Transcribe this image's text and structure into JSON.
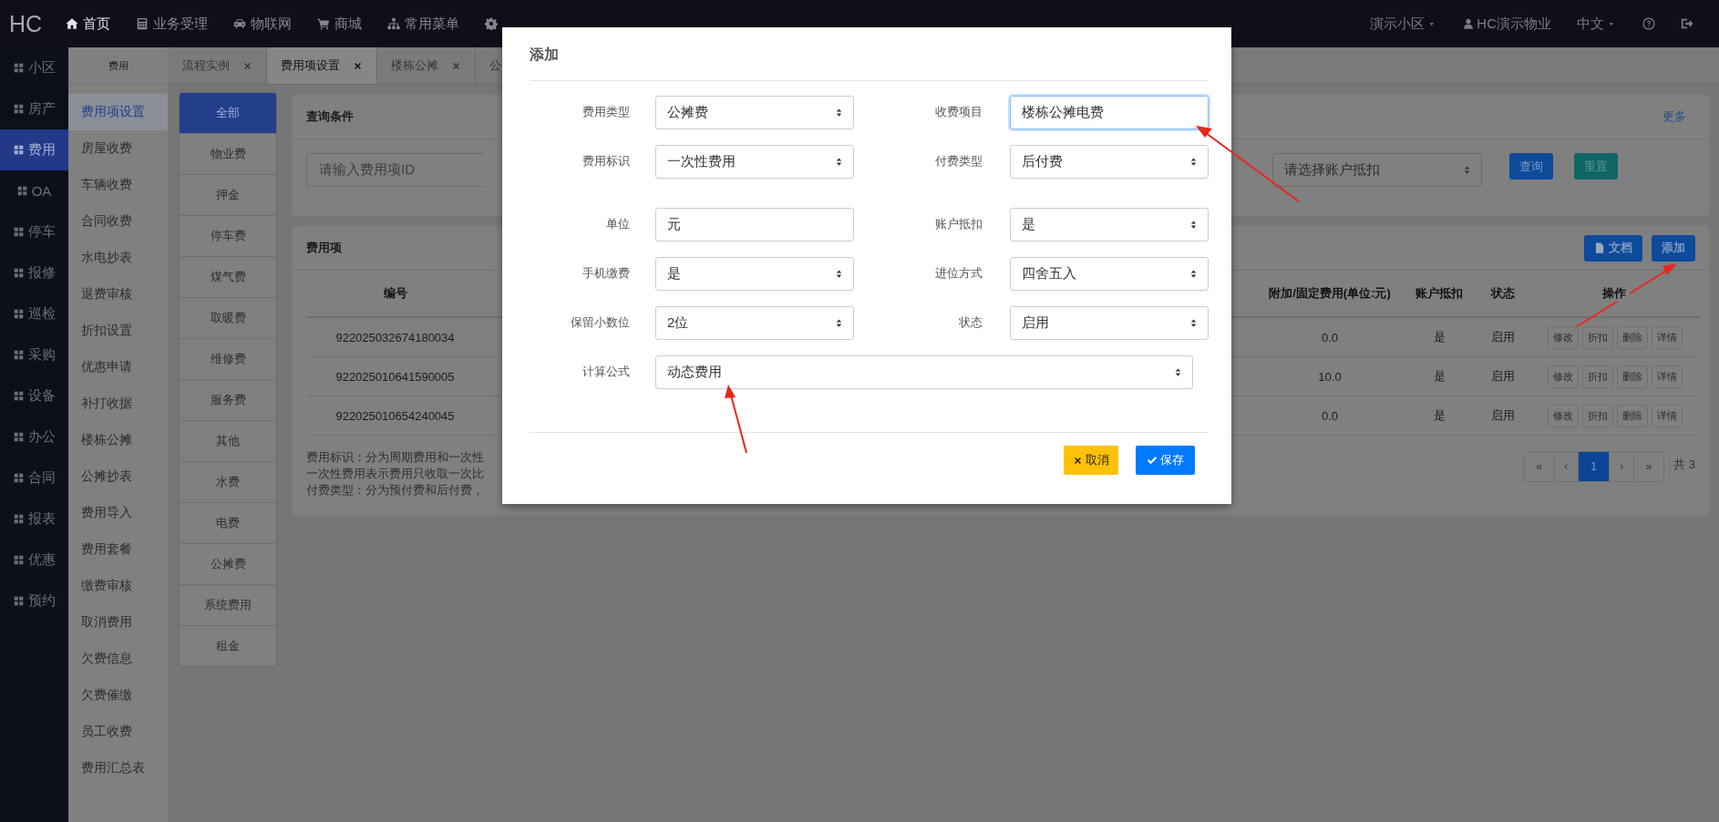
{
  "topbar": {
    "logo": "HC",
    "menu": [
      {
        "label": "首页",
        "kind": "home",
        "selected": true
      },
      {
        "label": "业务受理",
        "kind": "calculator",
        "selected": false
      },
      {
        "label": "物联网",
        "kind": "car",
        "selected": false
      },
      {
        "label": "商城",
        "kind": "cart",
        "selected": false
      },
      {
        "label": "常用菜单",
        "kind": "sitemap",
        "selected": false
      },
      {
        "kind": "gear",
        "selected": false
      }
    ],
    "right": [
      {
        "kind": "dropdown",
        "label": "演示小区"
      },
      {
        "kind": "user",
        "label": "HC演示物业"
      },
      {
        "kind": "dropdown",
        "label": "中文"
      },
      {
        "kind": "help"
      },
      {
        "kind": "logout"
      }
    ]
  },
  "main_nav": [
    {
      "label": "小区",
      "selected": false
    },
    {
      "label": "房产",
      "selected": false
    },
    {
      "label": "费用",
      "selected": true
    },
    {
      "label": "OA",
      "selected": false
    },
    {
      "label": "停车",
      "selected": false
    },
    {
      "label": "报修",
      "selected": false
    },
    {
      "label": "巡检",
      "selected": false
    },
    {
      "label": "采购",
      "selected": false
    },
    {
      "label": "设备",
      "selected": false
    },
    {
      "label": "办公",
      "selected": false
    },
    {
      "label": "合同",
      "selected": false
    },
    {
      "label": "报表",
      "selected": false
    },
    {
      "label": "优惠",
      "selected": false
    },
    {
      "label": "预约",
      "selected": false
    }
  ],
  "sub_nav": {
    "title": "费用",
    "items": [
      {
        "label": "费用项设置",
        "selected": true
      },
      {
        "label": "房屋收费",
        "selected": false
      },
      {
        "label": "车辆收费",
        "selected": false
      },
      {
        "label": "合同收费",
        "selected": false
      },
      {
        "label": "水电抄表",
        "selected": false
      },
      {
        "label": "退费审核",
        "selected": false
      },
      {
        "label": "折扣设置",
        "selected": false
      },
      {
        "label": "优惠申请",
        "selected": false
      },
      {
        "label": "补打收据",
        "selected": false
      },
      {
        "label": "楼栋公摊",
        "selected": false
      },
      {
        "label": "公摊抄表",
        "selected": false
      },
      {
        "label": "费用导入",
        "selected": false
      },
      {
        "label": "费用套餐",
        "selected": false
      },
      {
        "label": "缴费审核",
        "selected": false
      },
      {
        "label": "取消费用",
        "selected": false
      },
      {
        "label": "欠费信息",
        "selected": false
      },
      {
        "label": "欠费催缴",
        "selected": false
      },
      {
        "label": "员工收费",
        "selected": false
      },
      {
        "label": "费用汇总表",
        "selected": false
      }
    ]
  },
  "page_tabs": [
    {
      "label": "流程实例",
      "selected": false,
      "closable": true
    },
    {
      "label": "费用项设置",
      "selected": true,
      "closable": true
    },
    {
      "label": "楼栋公摊",
      "selected": false,
      "closable": true
    },
    {
      "label": "公",
      "selected": false,
      "closable": false
    }
  ],
  "categories": [
    {
      "label": "全部",
      "selected": true
    },
    {
      "label": "物业费",
      "selected": false
    },
    {
      "label": "押金",
      "selected": false
    },
    {
      "label": "停车费",
      "selected": false
    },
    {
      "label": "煤气费",
      "selected": false
    },
    {
      "label": "取暖费",
      "selected": false
    },
    {
      "label": "维修费",
      "selected": false
    },
    {
      "label": "服务费",
      "selected": false
    },
    {
      "label": "其他",
      "selected": false
    },
    {
      "label": "水费",
      "selected": false
    },
    {
      "label": "电费",
      "selected": false
    },
    {
      "label": "公摊费",
      "selected": false
    },
    {
      "label": "系统费用",
      "selected": false
    },
    {
      "label": "租金",
      "selected": false
    }
  ],
  "query": {
    "title": "查询条件",
    "more": "更多",
    "id_field": {
      "placeholder": "请输入费用项ID"
    },
    "deduct_select": {
      "placeholder": "请选择账户抵扣"
    },
    "buttons": [
      {
        "label": "查询",
        "kind": "primary"
      },
      {
        "label": "重置",
        "kind": "reset"
      }
    ]
  },
  "fees": {
    "title": "费用项",
    "buttons": [
      {
        "label": "文档",
        "kind": "doc"
      },
      {
        "label": "添加",
        "kind": "primary"
      }
    ],
    "columns": [
      "编号",
      "附加/固定费用(单位:元)",
      "账户抵扣",
      "状态",
      "操作"
    ],
    "rows": [
      {
        "id": "922025032674180034",
        "fixed": "0.0",
        "deduct": "是",
        "status": "启用",
        "actions": [
          "修改",
          "折扣",
          "删除",
          "详情"
        ]
      },
      {
        "id": "922025010641590005",
        "fixed": "10.0",
        "deduct": "是",
        "status": "启用",
        "actions": [
          "修改",
          "折扣",
          "删除",
          "详情"
        ]
      },
      {
        "id": "922025010654240045",
        "fixed": "0.0",
        "deduct": "是",
        "status": "启用",
        "actions": [
          "修改",
          "折扣",
          "删除",
          "详情"
        ]
      }
    ],
    "notes": [
      "费用标识：分为周期费用和一次性",
      "一次性费用表示费用只收取一次比",
      "付费类型：分为预付费和后付费，"
    ],
    "pagination": {
      "pages": [
        {
          "label": "«",
          "selected": false
        },
        {
          "label": "‹",
          "selected": false
        },
        {
          "label": "1",
          "selected": true
        },
        {
          "label": "›",
          "selected": false
        },
        {
          "label": "»",
          "selected": false
        }
      ],
      "total": "共 3"
    }
  },
  "modal": {
    "title": "添加",
    "fields": [
      {
        "label": "费用类型",
        "kind": "select",
        "value": "公摊费"
      },
      {
        "label": "收费项目",
        "kind": "text",
        "value": "楼栋公摊电费",
        "focused": true
      },
      {
        "label": "费用标识",
        "kind": "select",
        "value": "一次性费用"
      },
      {
        "label": "付费类型",
        "kind": "select",
        "value": "后付费"
      },
      {
        "label": "单位",
        "kind": "text",
        "value": "元",
        "focused": false
      },
      {
        "label": "账户抵扣",
        "kind": "select",
        "value": "是"
      },
      {
        "label": "手机缴费",
        "kind": "select",
        "value": "是"
      },
      {
        "label": "进位方式",
        "kind": "select",
        "value": "四舍五入"
      },
      {
        "label": "保留小数位",
        "kind": "select",
        "value": "2位"
      },
      {
        "label": "状态",
        "kind": "select",
        "value": "启用"
      },
      {
        "label": "计算公式",
        "kind": "select_wide",
        "value": "动态费用"
      }
    ],
    "buttons": [
      {
        "label": "取消",
        "kind": "cancel"
      },
      {
        "label": "保存",
        "kind": "save"
      }
    ]
  }
}
